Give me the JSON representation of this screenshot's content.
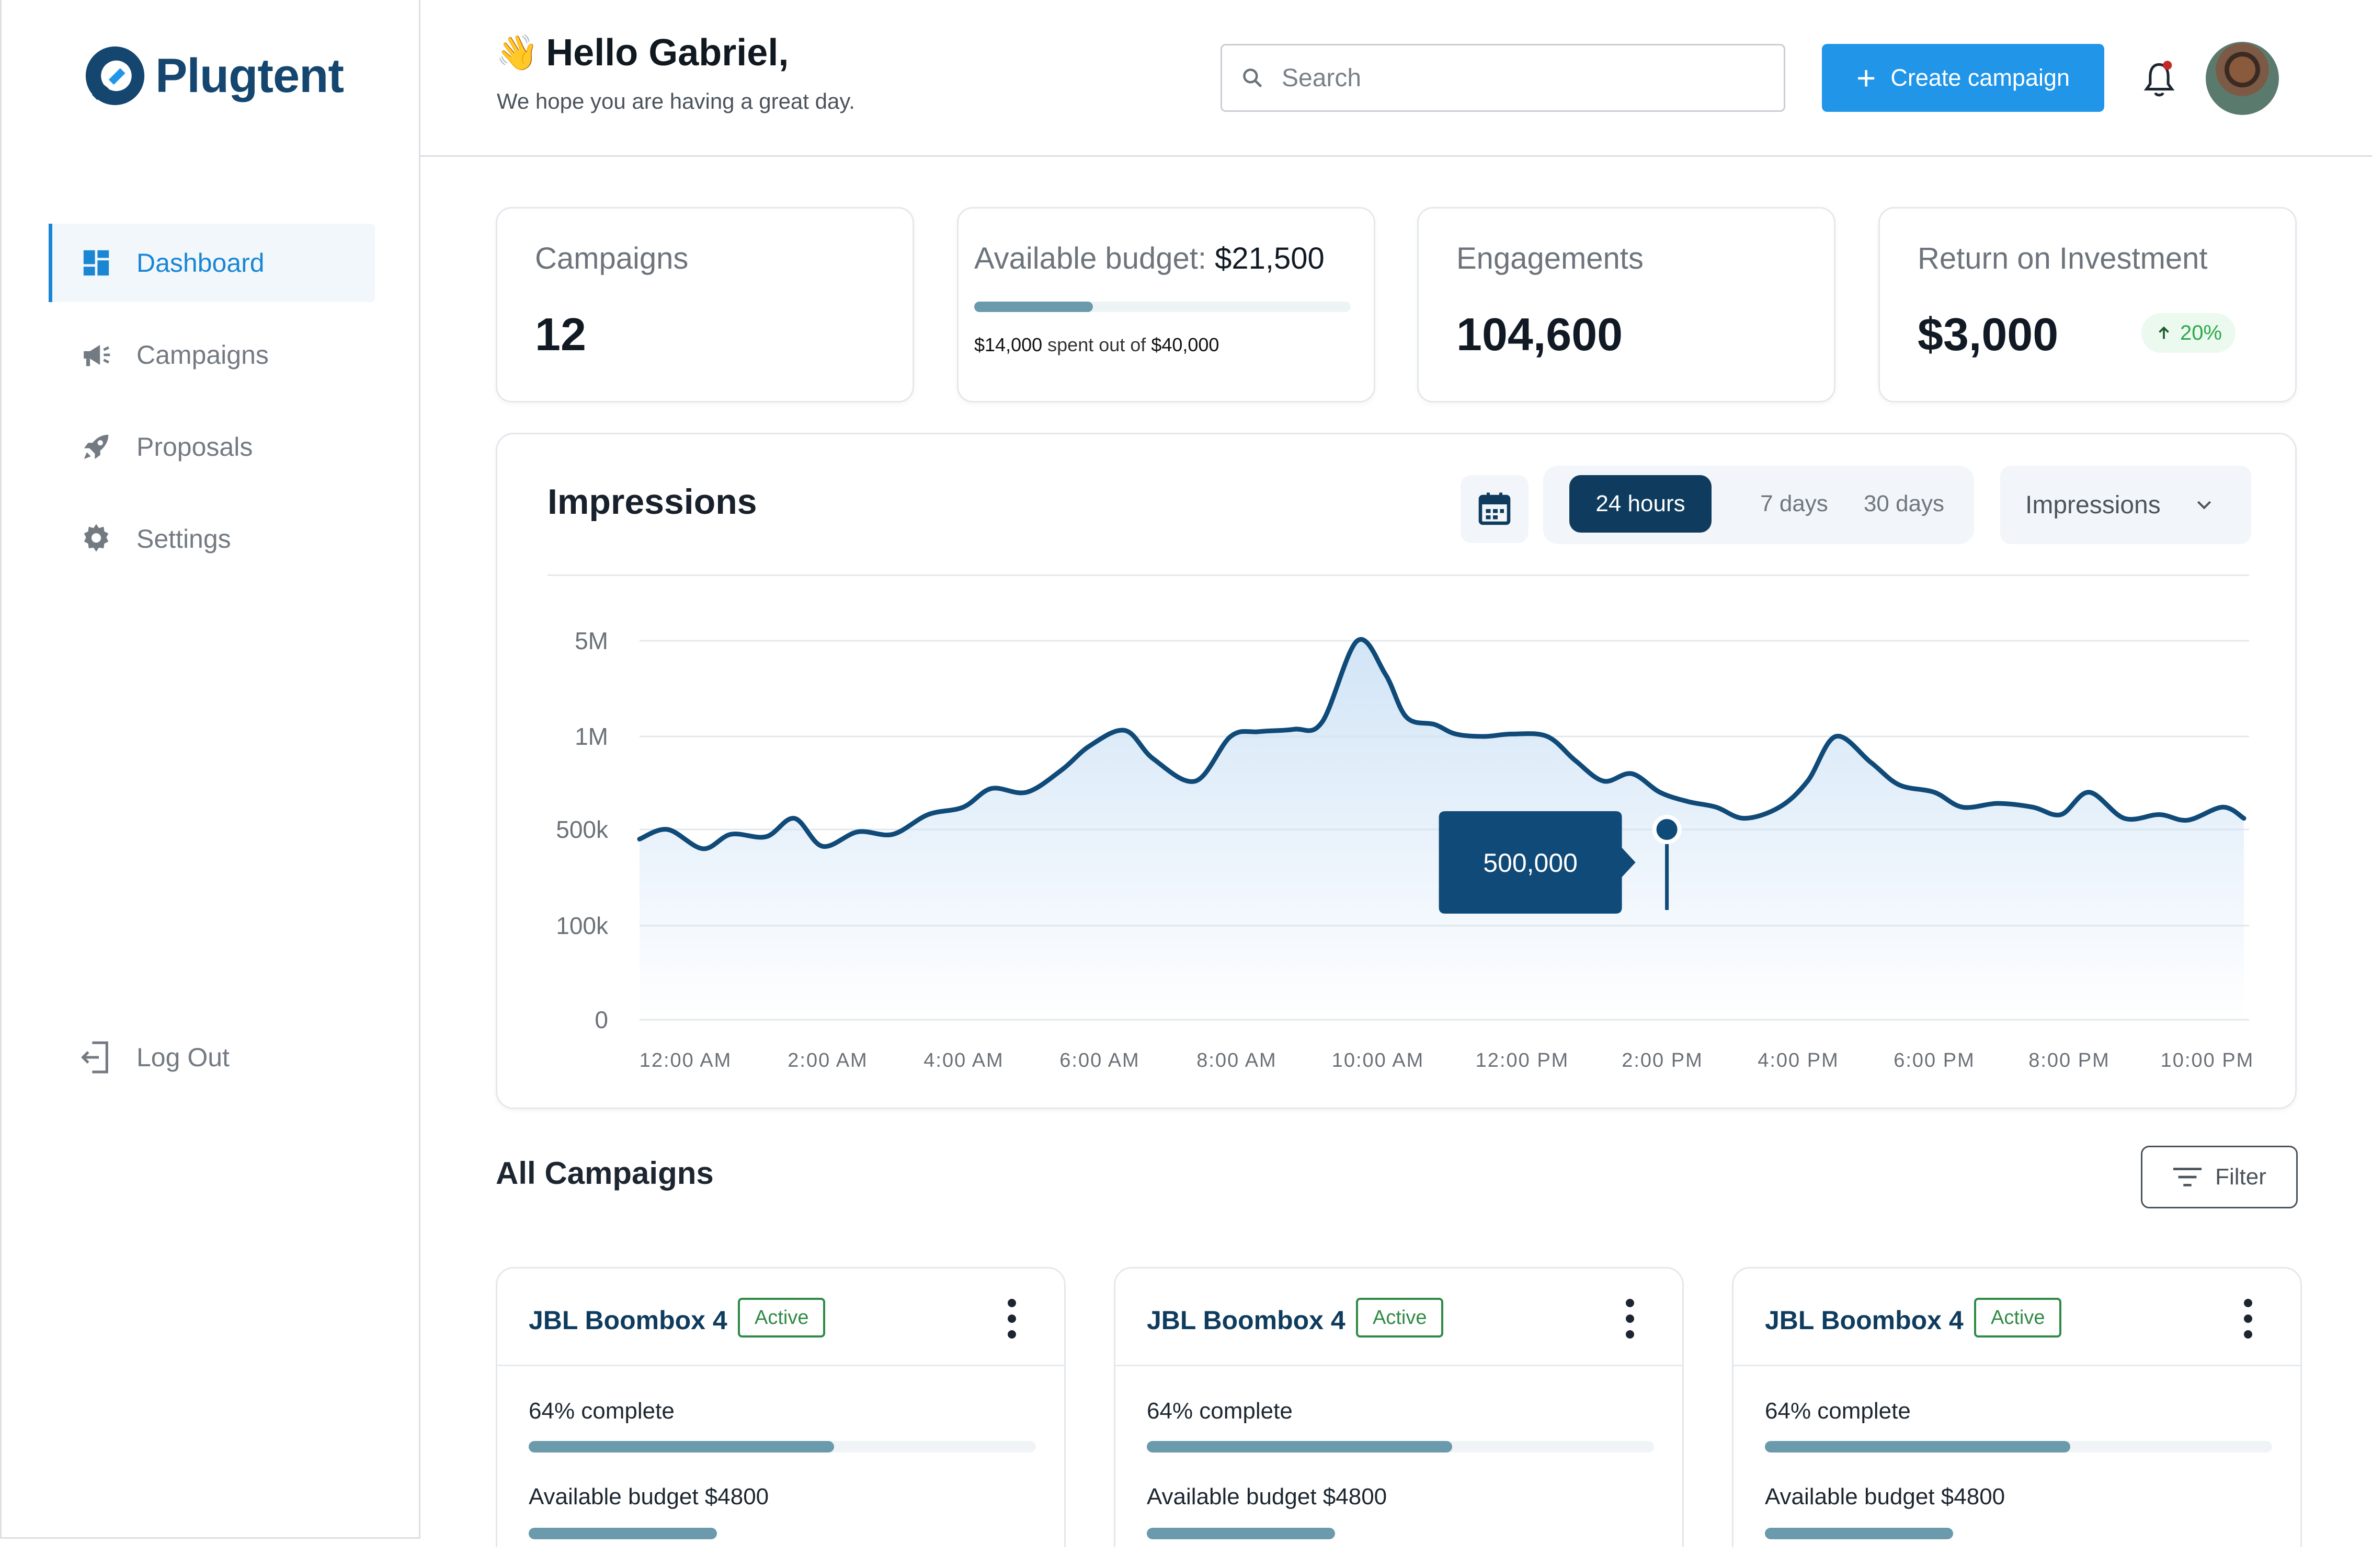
{
  "app": {
    "name": "Plugtent"
  },
  "sidebar": {
    "items": [
      {
        "label": "Dashboard",
        "icon": "dashboard-icon",
        "active": true
      },
      {
        "label": "Campaigns",
        "icon": "megaphone-icon",
        "active": false
      },
      {
        "label": "Proposals",
        "icon": "rocket-icon",
        "active": false
      },
      {
        "label": "Settings",
        "icon": "gear-icon",
        "active": false
      }
    ],
    "logout_label": "Log Out"
  },
  "header": {
    "greeting_emoji": "👋",
    "greeting": "Hello Gabriel,",
    "subtitle": "We hope you are having a great day.",
    "search_placeholder": "Search",
    "create_label": "Create campaign"
  },
  "stats": {
    "campaigns": {
      "label": "Campaigns",
      "value": "12"
    },
    "budget": {
      "label": "Available budget:",
      "value": "$21,500",
      "spent": "$14,000",
      "spent_text": "spent out of",
      "total": "$40,000",
      "progress": 0.35
    },
    "engagements": {
      "label": "Engagements",
      "value": "104,600"
    },
    "roi": {
      "label": "Return on Investment",
      "value": "$3,000",
      "change": "20%"
    }
  },
  "impressions": {
    "title": "Impressions",
    "ranges": [
      "24 hours",
      "7 days",
      "30 days"
    ],
    "active_range": "24 hours",
    "metric": "Impressions",
    "tooltip": "500,000"
  },
  "chart_data": {
    "type": "area",
    "title": "Impressions",
    "y_ticks": [
      "5M",
      "1M",
      "500k",
      "100k",
      "0"
    ],
    "x_ticks": [
      "12:00 AM",
      "2:00 AM",
      "4:00 AM",
      "6:00 AM",
      "8:00 AM",
      "10:00 AM",
      "12:00 PM",
      "2:00 PM",
      "4:00 PM",
      "6:00 PM",
      "8:00 PM",
      "10:00 PM"
    ],
    "series": [
      {
        "hours": [
          0,
          0.4,
          0.9,
          1.3,
          1.8,
          2.2,
          2.6,
          3.1,
          3.6,
          4.1,
          4.6,
          5.0,
          5.5,
          6.0,
          6.4,
          6.9,
          7.3,
          7.9,
          8.4,
          8.8,
          9.3,
          9.7,
          10.2,
          10.6,
          10.9,
          11.3,
          11.6,
          12.0,
          12.4,
          12.9,
          13.3,
          13.7,
          14.1,
          14.5,
          14.9,
          15.3,
          15.7,
          16.2,
          16.6,
          17.0,
          17.5,
          17.9,
          18.4,
          18.8,
          19.3,
          19.8,
          20.2,
          20.6,
          21.1,
          21.6,
          22.0,
          22.5,
          22.8
        ],
        "values": [
          460000,
          500000,
          420000,
          480000,
          470000,
          560000,
          430000,
          490000,
          480000,
          580000,
          620000,
          720000,
          700000,
          820000,
          950000,
          1250000,
          880000,
          760000,
          1000000,
          1200000,
          1300000,
          1600000,
          5000000,
          3600000,
          1800000,
          1500000,
          1100000,
          1000000,
          1100000,
          1000000,
          870000,
          760000,
          800000,
          700000,
          650000,
          620000,
          560000,
          620000,
          760000,
          1000000,
          860000,
          740000,
          700000,
          620000,
          640000,
          620000,
          580000,
          700000,
          560000,
          580000,
          550000,
          620000,
          560000
        ]
      }
    ],
    "highlight": {
      "hour": 14.6,
      "value": 500000,
      "label": "500,000"
    }
  },
  "campaigns_section": {
    "title": "All Campaigns",
    "filter_label": "Filter",
    "cards": [
      {
        "name": "JBL Boombox 4",
        "status": "Active",
        "progress_text": "64% complete",
        "progress": 0.64,
        "budget_text": "Available budget $4800"
      },
      {
        "name": "JBL Boombox 4",
        "status": "Active",
        "progress_text": "64% complete",
        "progress": 0.64,
        "budget_text": "Available budget $4800"
      },
      {
        "name": "JBL Boombox 4",
        "status": "Active",
        "progress_text": "64% complete",
        "progress": 0.64,
        "budget_text": "Available budget $4800"
      }
    ]
  },
  "colors": {
    "brand": "#14466f",
    "accent": "#2196e8",
    "chart_line": "#0f4a78",
    "success": "#2da84a",
    "progress": "#6a9aab"
  }
}
